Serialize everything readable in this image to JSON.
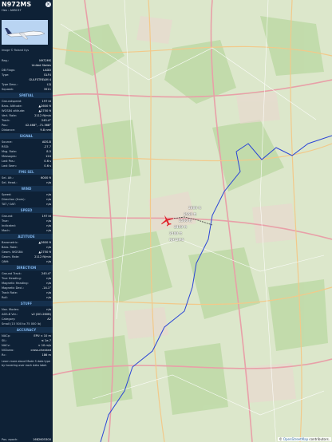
{
  "aircraft": {
    "callsign": "N972MS",
    "hex_line": "Hex : A0BC37",
    "image_credit": "Image © Roland Uys"
  },
  "info": [
    {
      "k": "Reg.:",
      "v": "N972MS"
    },
    {
      "k": "",
      "v": "United States"
    },
    {
      "k": "DB Flags:",
      "v": "LADD"
    },
    {
      "k": "Type:",
      "v": "GLF4"
    },
    {
      "k": "",
      "v": "GULFSTREAM 4"
    },
    {
      "k": "Type Desc.:",
      "v": "L2J"
    },
    {
      "k": "Squawk:",
      "v": "3511"
    }
  ],
  "sections": [
    {
      "title": "SPATIAL",
      "rows": [
        {
          "k": "Groundspeed:",
          "v": "197 kt"
        },
        {
          "k": "Baro. Altitude:",
          "v": "▲2600 ft"
        },
        {
          "k": "WGS84 altitude:",
          "v": "▲2750 ft"
        },
        {
          "k": "Vert. Rate:",
          "v": "2112 ft/min"
        },
        {
          "k": "Track:",
          "v": "245.4°"
        },
        {
          "k": "Pos.:",
          "v": "42.468°, -71.368°"
        },
        {
          "k": "Distance:",
          "v": "9.8 nmi"
        }
      ]
    },
    {
      "title": "SIGNAL",
      "rows": [
        {
          "k": "Source:",
          "v": "ADS-B"
        },
        {
          "k": "RSSI:",
          "v": "-27.7"
        },
        {
          "k": "Msg. Rate:",
          "v": "8.5"
        },
        {
          "k": "Messages:",
          "v": "124"
        },
        {
          "k": "Last Pos.:",
          "v": "0.6 s"
        },
        {
          "k": "Last Seen:",
          "v": "0.6 s"
        }
      ]
    },
    {
      "title": "FMS SEL",
      "rows": [
        {
          "k": "Sel. Alt.:",
          "v": "6000 ft"
        },
        {
          "k": "Sel. Head.:",
          "v": "n/a"
        }
      ]
    },
    {
      "title": "WIND",
      "rows": [
        {
          "k": "Speed:",
          "v": "n/a"
        },
        {
          "k": "Direction (from):",
          "v": "n/a"
        },
        {
          "k": "TAT / OAT:",
          "v": "n/a"
        }
      ]
    },
    {
      "title": "SPEED",
      "rows": [
        {
          "k": "Ground:",
          "v": "197 kt"
        },
        {
          "k": "True:",
          "v": "n/a"
        },
        {
          "k": "Indicated:",
          "v": "n/a"
        },
        {
          "k": "Mach:",
          "v": "n/a"
        }
      ]
    },
    {
      "title": "ALTITUDE",
      "rows": [
        {
          "k": "Barometric:",
          "v": "▲2600 ft"
        },
        {
          "k": "Baro. Rate:",
          "v": "n/a"
        },
        {
          "k": "Geom. WGS84:",
          "v": "▲2750 ft"
        },
        {
          "k": "Geom. Rate:",
          "v": "2112 ft/min"
        },
        {
          "k": "QNH:",
          "v": "n/a"
        }
      ]
    },
    {
      "title": "DIRECTION",
      "rows": [
        {
          "k": "Ground Track:",
          "v": "245.4°"
        },
        {
          "k": "True Heading:",
          "v": "n/a"
        },
        {
          "k": "Magnetic Heading:",
          "v": "n/a"
        },
        {
          "k": "Magnetic Decl.:",
          "v": "-14.1°"
        },
        {
          "k": "Track Rate:",
          "v": "n/a"
        },
        {
          "k": "Roll:",
          "v": "n/a"
        }
      ]
    },
    {
      "title": "STUFF",
      "rows": [
        {
          "k": "Nav. Modes:",
          "v": "n/a"
        },
        {
          "k": "ADS-B Ver.:",
          "v": "v2 (DO-260B)"
        },
        {
          "k": "Category:",
          "v": "A2"
        },
        {
          "k": "Small (15 500 to 75 000 lb)",
          "v": ""
        }
      ]
    },
    {
      "title": "ACCURACY",
      "rows": [
        {
          "k": "NACp:",
          "v": "EPU < 10 m"
        },
        {
          "k": "SIL:",
          "v": "≤ 1e-7"
        },
        {
          "k": "NACv:",
          "v": "< 10 m/s"
        },
        {
          "k": "NICbaro:",
          "v": "cross-checked"
        },
        {
          "k": "Rc:",
          "v": "186 m"
        }
      ]
    }
  ],
  "note": "Learn more about Mode S data type by hovering over each data label.",
  "footer": {
    "k": "Pos. epoch:",
    "v": "1682605300"
  },
  "map": {
    "attribution_prefix": "© ",
    "attribution_link": "OpenStreetMap",
    "attribution_suffix": " contributors.",
    "aircraft_color": "#e0202a",
    "track_labels": [
      "2600 ft",
      "2550 ft",
      "2500 ft",
      "2450 ft",
      "2400 ft",
      "N972MS"
    ]
  }
}
